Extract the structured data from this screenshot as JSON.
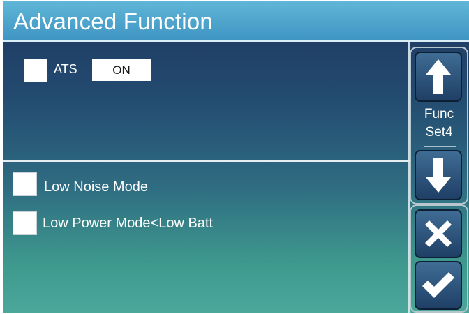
{
  "header": {
    "title": "Advanced Function"
  },
  "ats": {
    "label": "ATS",
    "value": "ON",
    "checked": false
  },
  "options": [
    {
      "label": "Low Noise Mode",
      "checked": false
    },
    {
      "label": "Low Power Mode<Low Batt",
      "checked": false
    }
  ],
  "nav": {
    "func_line1": "Func",
    "func_line2": "Set4",
    "up_icon": "arrow-up-icon",
    "down_icon": "arrow-down-icon",
    "cancel_icon": "close-icon",
    "confirm_icon": "checkmark-icon"
  },
  "colors": {
    "title_bar": "#4aa6cf",
    "background_top": "#1e3760",
    "background_bottom": "#4aa79a",
    "button": "#2d537c"
  }
}
